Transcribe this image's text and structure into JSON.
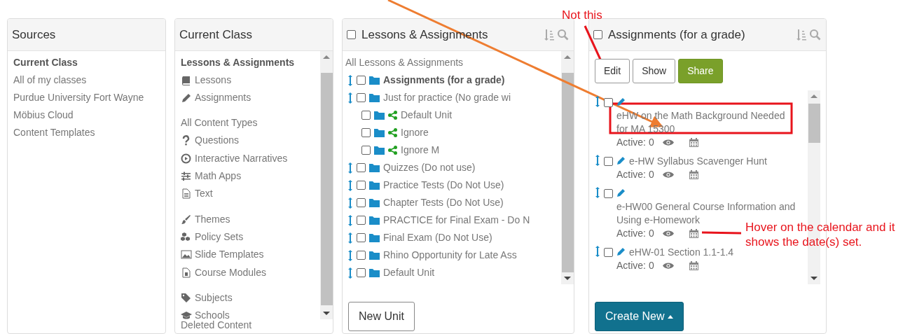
{
  "sources": {
    "title": "Sources",
    "items": [
      {
        "label": "Current Class",
        "selected": true
      },
      {
        "label": "All of my classes",
        "selected": false
      },
      {
        "label": "Purdue University Fort Wayne",
        "selected": false
      },
      {
        "label": "Möbius Cloud",
        "selected": false
      },
      {
        "label": "Content Templates",
        "selected": false
      }
    ]
  },
  "current_class": {
    "title": "Current Class",
    "groups": [
      [
        {
          "kind": "heading",
          "label": "Lessons & Assignments"
        },
        {
          "kind": "book",
          "label": "Lessons"
        },
        {
          "kind": "pencil",
          "label": "Assignments"
        }
      ],
      [
        {
          "kind": "plain",
          "label": "All Content Types"
        },
        {
          "kind": "question",
          "label": "Questions"
        },
        {
          "kind": "play",
          "label": "Interactive Narratives"
        },
        {
          "kind": "sliders",
          "label": "Math Apps"
        },
        {
          "kind": "file",
          "label": "Text"
        }
      ],
      [
        {
          "kind": "brush",
          "label": "Themes"
        },
        {
          "kind": "cubes",
          "label": "Policy Sets"
        },
        {
          "kind": "image",
          "label": "Slide Templates"
        },
        {
          "kind": "module",
          "label": "Course Modules"
        }
      ],
      [
        {
          "kind": "tag",
          "label": "Subjects"
        },
        {
          "kind": "cap",
          "label": "Schools"
        }
      ]
    ],
    "footer": "Deleted Content"
  },
  "lessons": {
    "title": "Lessons & Assignments",
    "checked": false,
    "root": "All Lessons & Assignments",
    "units": [
      {
        "label": "Assignments (for a grade)",
        "selected": true,
        "checked": false,
        "shared": false
      },
      {
        "label": "Just for practice (No grade wi",
        "selected": false,
        "checked": false,
        "shared": false,
        "children": [
          {
            "label": "Default Unit",
            "selected": false,
            "checked": false,
            "shared": true
          },
          {
            "label": "Ignore",
            "selected": false,
            "checked": false,
            "shared": true
          },
          {
            "label": "Ignore M",
            "selected": false,
            "checked": false,
            "shared": true
          }
        ]
      },
      {
        "label": "Quizzes (Do not use)",
        "selected": false,
        "checked": false,
        "shared": false
      },
      {
        "label": "Practice Tests (Do Not Use)",
        "selected": false,
        "checked": false,
        "shared": false
      },
      {
        "label": "Chapter Tests (Do Not Use)",
        "selected": false,
        "checked": false,
        "shared": false
      },
      {
        "label": "PRACTICE for Final Exam - Do N",
        "selected": false,
        "checked": false,
        "shared": false
      },
      {
        "label": "Final Exam (Do Not Use)",
        "selected": false,
        "checked": false,
        "shared": false
      },
      {
        "label": "Rhino Opportunity for Late Ass",
        "selected": false,
        "checked": false,
        "shared": false
      },
      {
        "label": "Default Unit",
        "selected": false,
        "checked": false,
        "shared": false
      }
    ],
    "button": "New Unit"
  },
  "assignments": {
    "title": "Assignments (for a grade)",
    "checked": false,
    "buttons": [
      {
        "label": "Edit",
        "kind": "outline"
      },
      {
        "label": "Show",
        "kind": "outline"
      },
      {
        "label": "Share",
        "kind": "success"
      }
    ],
    "items": [
      {
        "title": "eHW on the Math Background Needed for MA 15300",
        "status": "Active: 0",
        "checked": false
      },
      {
        "title": "e-HW Syllabus Scavenger Hunt",
        "status": "Active: 0",
        "checked": false
      },
      {
        "title": "e-HW00 General Course Information and Using e-Homework",
        "status": "Active: 0",
        "checked": false
      },
      {
        "title": "eHW-01 Section 1.1-1.4",
        "status": "Active: 0",
        "checked": false
      }
    ],
    "create_button": "Create New"
  },
  "annotations": [
    {
      "kind": "callout",
      "text": "Not this"
    },
    {
      "kind": "callout",
      "text": "Hover on the calendar and it shows the date(s) set."
    }
  ]
}
